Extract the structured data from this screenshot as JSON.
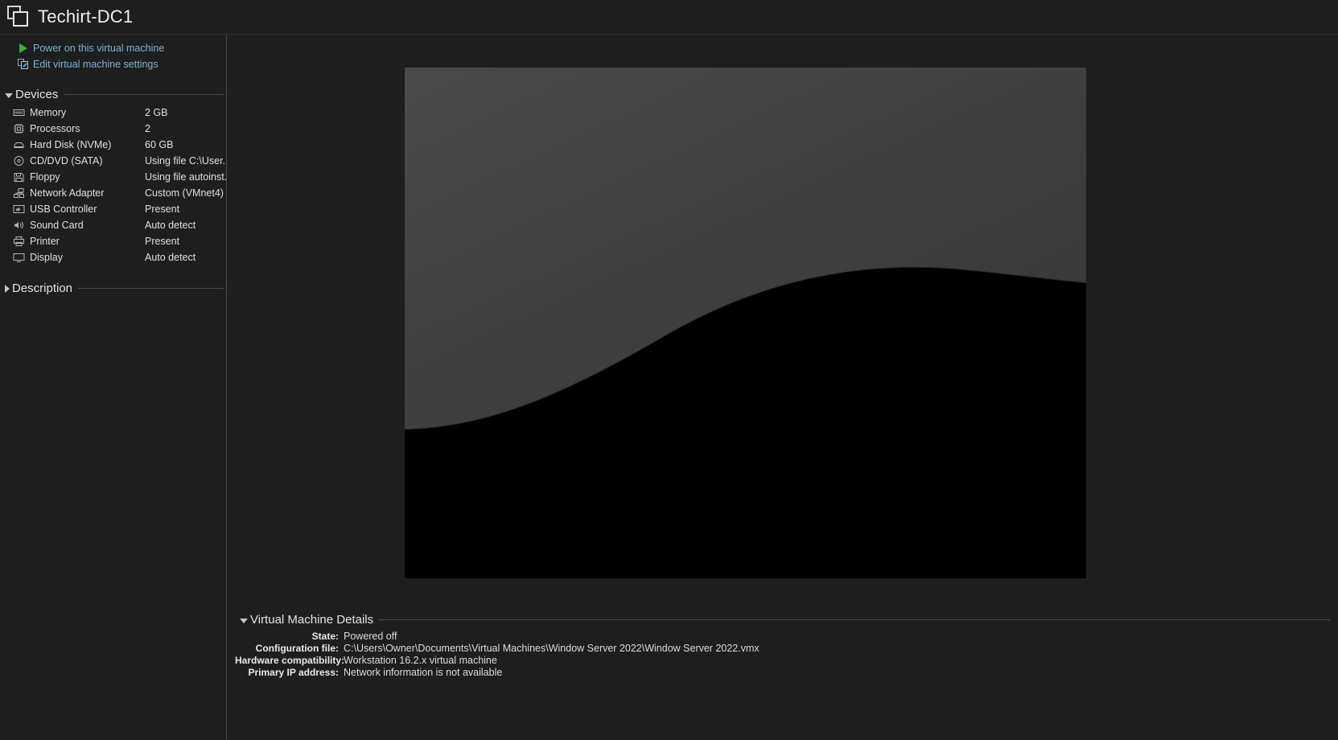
{
  "window": {
    "vm_icon": "virtual-machine-icon",
    "title": "Techirt-DC1"
  },
  "actions": [
    {
      "id": "power-on",
      "icon": "play-triangle-icon",
      "label": "Power on this virtual machine"
    },
    {
      "id": "edit-settings",
      "icon": "edit-settings-icon",
      "label": "Edit virtual machine settings"
    }
  ],
  "devices_section": {
    "label": "Devices",
    "expanded": true,
    "items": [
      {
        "icon": "memory-icon",
        "name": "Memory",
        "value": "2 GB"
      },
      {
        "icon": "processor-icon",
        "name": "Processors",
        "value": "2"
      },
      {
        "icon": "harddisk-icon",
        "name": "Hard Disk (NVMe)",
        "value": "60 GB"
      },
      {
        "icon": "cddvd-icon",
        "name": "CD/DVD (SATA)",
        "value": "Using file C:\\User..."
      },
      {
        "icon": "floppy-icon",
        "name": "Floppy",
        "value": "Using file autoinst..."
      },
      {
        "icon": "network-icon",
        "name": "Network Adapter",
        "value": "Custom (VMnet4)"
      },
      {
        "icon": "usb-icon",
        "name": "USB Controller",
        "value": "Present"
      },
      {
        "icon": "soundcard-icon",
        "name": "Sound Card",
        "value": "Auto detect"
      },
      {
        "icon": "printer-icon",
        "name": "Printer",
        "value": "Present"
      },
      {
        "icon": "display-icon",
        "name": "Display",
        "value": "Auto detect"
      }
    ]
  },
  "description_section": {
    "label": "Description",
    "expanded": false
  },
  "details_section": {
    "label": "Virtual Machine Details",
    "expanded": true,
    "rows": [
      {
        "label": "State:",
        "value": "Powered off"
      },
      {
        "label": "Configuration file:",
        "value": "C:\\Users\\Owner\\Documents\\Virtual Machines\\Window Server 2022\\Window Server 2022.vmx"
      },
      {
        "label": "Hardware compatibility:",
        "value": "Workstation 16.2.x virtual machine"
      },
      {
        "label": "Primary IP address:",
        "value": "Network information is not available"
      }
    ]
  },
  "thumbnail": {
    "name": "vm-screen-thumbnail",
    "description": "Windows Server 2022 boot wallpaper",
    "top_color": "#3f3f3f",
    "bottom_color": "#000000"
  },
  "theme": {
    "background": "#1e1e1e",
    "link_color": "#7fb2d6",
    "text_color": "#e0e0e0",
    "divider_color": "#4a4a4a",
    "power_green": "#3fae3f"
  }
}
